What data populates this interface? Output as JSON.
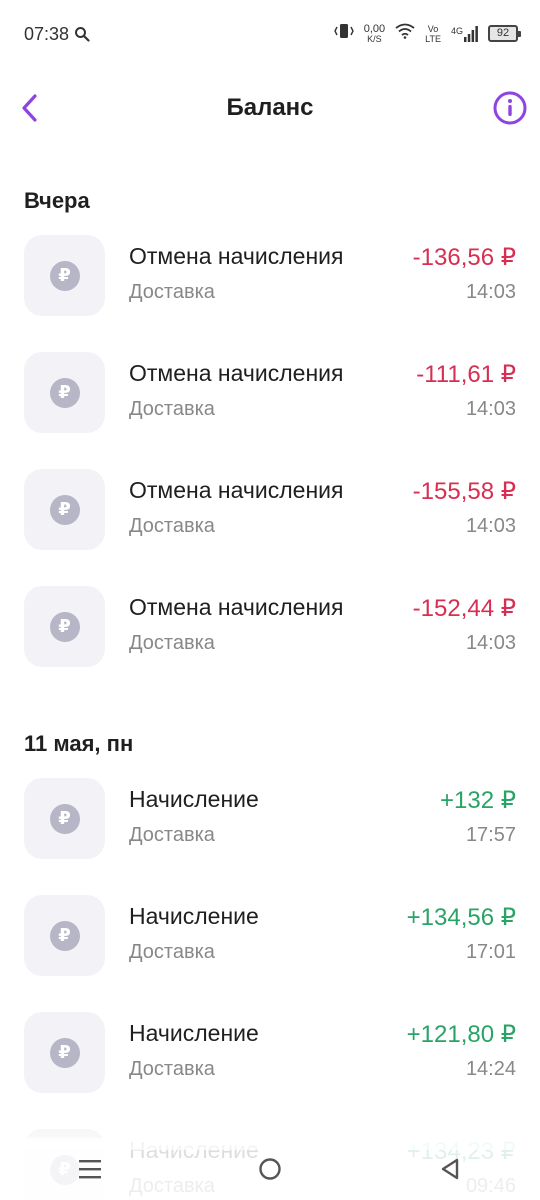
{
  "status_bar": {
    "time": "07:38",
    "net_speed_value": "0,00",
    "net_speed_unit": "K/S",
    "volte_top": "Vo",
    "volte_bottom": "LTE",
    "network": "4G",
    "battery": "92"
  },
  "header": {
    "title": "Баланс",
    "accent_color": "#8e44e0"
  },
  "colors": {
    "negative": "#d72e52",
    "positive": "#2aa366",
    "muted": "#888888"
  },
  "currency_symbol": "₽",
  "sections": [
    {
      "title": "Вчера",
      "items": [
        {
          "title": "Отмена начисления",
          "subtitle": "Доставка",
          "amount": "-136,56 ₽",
          "time": "14:03",
          "type": "negative"
        },
        {
          "title": "Отмена начисления",
          "subtitle": "Доставка",
          "amount": "-111,61 ₽",
          "time": "14:03",
          "type": "negative"
        },
        {
          "title": "Отмена начисления",
          "subtitle": "Доставка",
          "amount": "-155,58 ₽",
          "time": "14:03",
          "type": "negative"
        },
        {
          "title": "Отмена начисления",
          "subtitle": "Доставка",
          "amount": "-152,44 ₽",
          "time": "14:03",
          "type": "negative"
        }
      ]
    },
    {
      "title": "11 мая, пн",
      "items": [
        {
          "title": "Начисление",
          "subtitle": "Доставка",
          "amount": "+132 ₽",
          "time": "17:57",
          "type": "positive"
        },
        {
          "title": "Начисление",
          "subtitle": "Доставка",
          "amount": "+134,56 ₽",
          "time": "17:01",
          "type": "positive"
        },
        {
          "title": "Начисление",
          "subtitle": "Доставка",
          "amount": "+121,80 ₽",
          "time": "14:24",
          "type": "positive"
        },
        {
          "title": "Начисление",
          "subtitle": "Доставка",
          "amount": "+134,23 ₽",
          "time": "09:46",
          "type": "positive"
        }
      ]
    }
  ],
  "nav": {
    "buttons": [
      "menu-icon",
      "home-circle-icon",
      "back-triangle-icon"
    ]
  }
}
